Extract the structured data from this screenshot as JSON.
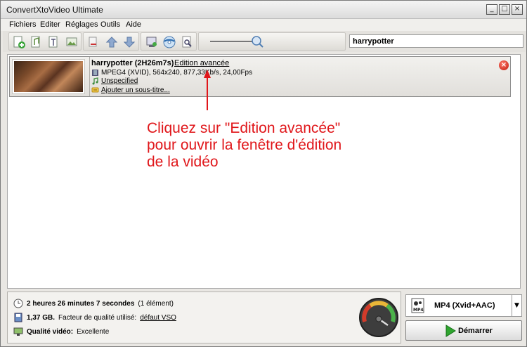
{
  "window": {
    "title": "ConvertXtoVideo Ultimate",
    "controls": [
      "_",
      "□",
      "×"
    ]
  },
  "menu": [
    "Fichiers",
    "Editer",
    "Réglages",
    "Outils",
    "Aide"
  ],
  "search": {
    "value": "harrypotter"
  },
  "item": {
    "title": "harrypotter (2H26m7s)",
    "advanced_link": "Edition avancée",
    "video_info": "MPEG4 (XVID), 564x240, 877,33Kb/s, 24,00Fps",
    "audio": "Unspecified",
    "subtitle": "Ajouter un sous-titre..."
  },
  "annotation": "Cliquez sur \"Edition avancée\"\npour ouvrir la fenêtre d'édition\nde la vidéo",
  "footer": {
    "duration_bold": "2 heures 26 minutes 7 secondes",
    "duration_count": "(1 élément)",
    "size_bold": "1,37 GB.",
    "quality_factor_text": "Facteur de qualité utilisé:",
    "quality_factor_link": "défaut VSO",
    "video_quality_label": "Qualité vidéo:",
    "video_quality_value": "Excellente"
  },
  "format": {
    "label": "MP4 (Xvid+AAC)",
    "icon_text": "MP4"
  },
  "start_button": {
    "label": "Démarrer"
  },
  "colors": {
    "annotation": "#e0161a",
    "start_arrow": "#2fa52f"
  }
}
